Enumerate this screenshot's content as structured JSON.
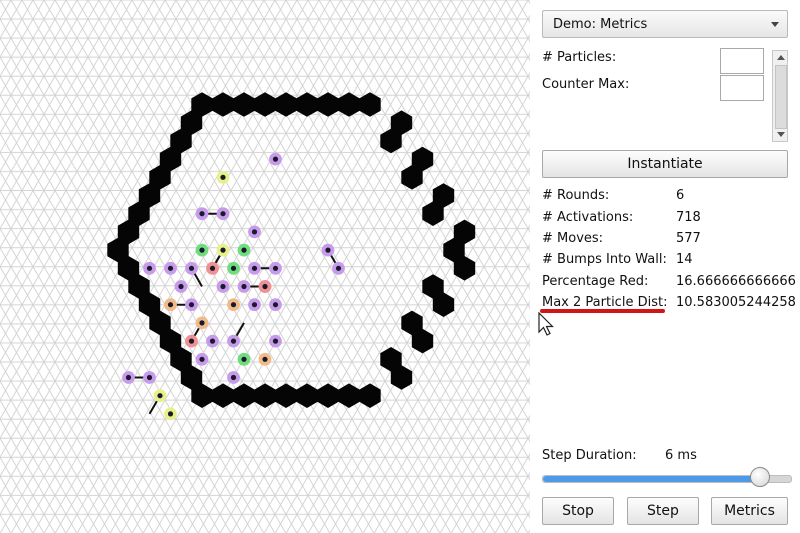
{
  "demo_select": {
    "value": "Demo: Metrics"
  },
  "params": {
    "particles_label": "# Particles:",
    "counter_max_label": "Counter Max:"
  },
  "instantiate_label": "Instantiate",
  "metrics": [
    {
      "key": "# Rounds:",
      "value": "6"
    },
    {
      "key": "# Activations:",
      "value": "718"
    },
    {
      "key": "# Moves:",
      "value": "577"
    },
    {
      "key": "# Bumps Into Wall:",
      "value": "14"
    },
    {
      "key": "Percentage Red:",
      "value": "16.666666666666"
    },
    {
      "key": "Max 2 Particle Dist:",
      "value": "10.583005244258"
    }
  ],
  "step_duration": {
    "label": "Step Duration:",
    "value": "6 ms",
    "slider_fraction": 0.88
  },
  "buttons": {
    "stop": "Stop",
    "step": "Step",
    "metrics": "Metrics"
  },
  "colors": {
    "slider_fill": "#4d9be8",
    "highlight_underline": "#d21414"
  },
  "particle_colors": {
    "purple": "#c79bea",
    "green": "#6fdc7e",
    "orange": "#f0bb88",
    "red": "#f09090",
    "yellow": "#e8f08a"
  },
  "particles": [
    {
      "c": "yellow",
      "q": 5,
      "r": 4,
      "dir": null
    },
    {
      "c": "purple",
      "q": 7,
      "r": 3,
      "dir": null
    },
    {
      "c": "purple",
      "q": 4,
      "r": 6,
      "dir": 0
    },
    {
      "c": "purple",
      "q": 5,
      "r": 6,
      "dir": null
    },
    {
      "c": "purple",
      "q": 6,
      "r": 9,
      "dir": 0
    },
    {
      "c": "purple",
      "q": 7,
      "r": 9,
      "dir": null
    },
    {
      "c": "purple",
      "q": 6,
      "r": 10,
      "dir": 0
    },
    {
      "c": "purple",
      "q": 7,
      "r": 10,
      "dir": null
    },
    {
      "c": "purple",
      "q": 6,
      "r": 7,
      "dir": null
    },
    {
      "c": "green",
      "q": 4,
      "r": 8,
      "dir": null
    },
    {
      "c": "yellow",
      "q": 5,
      "r": 8,
      "dir": 4
    },
    {
      "c": "green",
      "q": 6,
      "r": 8,
      "dir": null
    },
    {
      "c": "purple",
      "q": 10,
      "r": 8,
      "dir": 5
    },
    {
      "c": "purple",
      "q": 1,
      "r": 9,
      "dir": null
    },
    {
      "c": "purple",
      "q": 2,
      "r": 9,
      "dir": null
    },
    {
      "c": "purple",
      "q": 3,
      "r": 9,
      "dir": 5
    },
    {
      "c": "red",
      "q": 4,
      "r": 9,
      "dir": 1
    },
    {
      "c": "green",
      "q": 5,
      "r": 9,
      "dir": null
    },
    {
      "c": "purple",
      "q": 10,
      "r": 9,
      "dir": null
    },
    {
      "c": "purple",
      "q": 3,
      "r": 10,
      "dir": null
    },
    {
      "c": "purple",
      "q": 5,
      "r": 10,
      "dir": null
    },
    {
      "c": "red",
      "q": 7,
      "r": 10,
      "dir": null
    },
    {
      "c": "orange",
      "q": 2,
      "r": 11,
      "dir": 0
    },
    {
      "c": "purple",
      "q": 3,
      "r": 11,
      "dir": null
    },
    {
      "c": "orange",
      "q": 5,
      "r": 11,
      "dir": null
    },
    {
      "c": "purple",
      "q": 6,
      "r": 11,
      "dir": null
    },
    {
      "c": "purple",
      "q": 7,
      "r": 11,
      "dir": null
    },
    {
      "c": "orange",
      "q": 4,
      "r": 12,
      "dir": null
    },
    {
      "c": "red",
      "q": 3,
      "r": 13,
      "dir": 1
    },
    {
      "c": "purple",
      "q": 4,
      "r": 13,
      "dir": null
    },
    {
      "c": "purple",
      "q": 5,
      "r": 13,
      "dir": 1
    },
    {
      "c": "purple",
      "q": 7,
      "r": 13,
      "dir": null
    },
    {
      "c": "purple",
      "q": 4,
      "r": 14,
      "dir": null
    },
    {
      "c": "green",
      "q": 6,
      "r": 14,
      "dir": null
    },
    {
      "c": "orange",
      "q": 7,
      "r": 14,
      "dir": null
    },
    {
      "c": "purple",
      "q": 5,
      "r": 15,
      "dir": null
    },
    {
      "c": "purple",
      "q": 0,
      "r": 15,
      "dir": 0
    },
    {
      "c": "purple",
      "q": 1,
      "r": 15,
      "dir": null
    },
    {
      "c": "yellow",
      "q": 2,
      "r": 16,
      "dir": 4
    },
    {
      "c": "yellow",
      "q": 2,
      "r": 17,
      "dir": null
    }
  ]
}
